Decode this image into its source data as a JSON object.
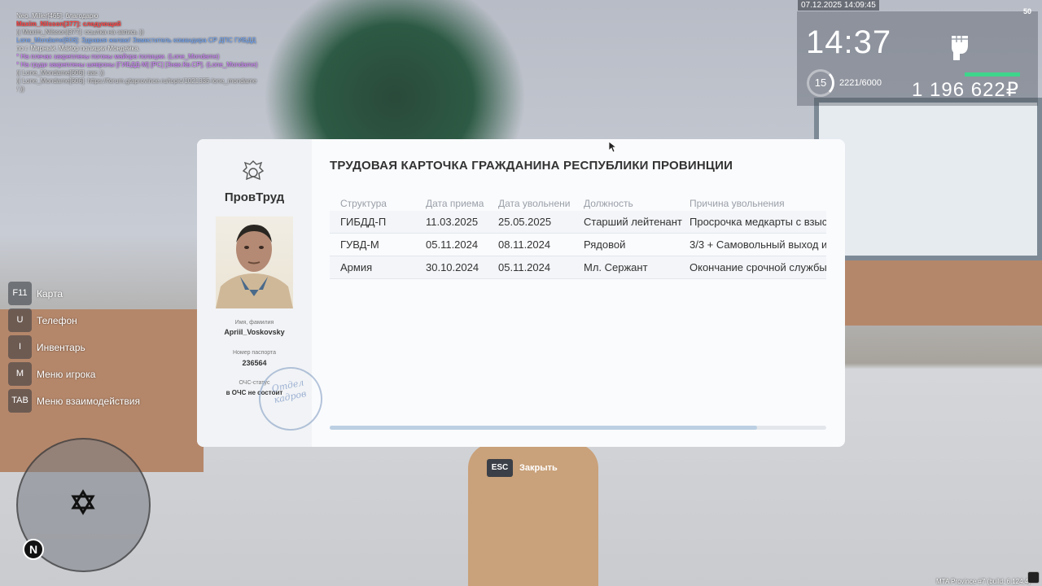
{
  "chat": [
    {
      "text": "Neo_Miller[465]: благодарю",
      "color": "#e8e8e8"
    },
    {
      "text": "Maxim_Nilsson[377]: следующий",
      "color": "#ff4444"
    },
    {
      "text": "(( Maxim_Nilsson[377]: ссылка на запись ))",
      "color": "#cfcfcf"
    },
    {
      "text": "Lone_Mondame[606]: Здравия желаю! Заместитель командира СР ДПС ГИБДД",
      "color": "#6fa8ff"
    },
    {
      "text": "по г. Мирный, Майор полиции Мондейка.",
      "color": "#e8e8e8"
    },
    {
      "text": "* На плечах закреплены погоны майора полиции. (Lone_Mondame)",
      "color": "#d07dff"
    },
    {
      "text": "* На груди закреплены шевроны [ГИБДД-М] [РС] [Знак.Кв.СР]. (Lone_Mondame)",
      "color": "#d07dff"
    },
    {
      "text": "(( Lone_Mondame[606]: вас ))",
      "color": "#cfcfcf"
    },
    {
      "text": "(( Lone_Mondame[606]: https://forum.gtaprovince.ru/topic/1021335-lone_mondame",
      "color": "#cfcfcf"
    },
    {
      "text": "/ ))",
      "color": "#cfcfcf"
    }
  ],
  "hud": {
    "datetime": "07.12.2025 14:09:45",
    "fps": "50",
    "time": "14:37",
    "level": "15",
    "xp": "2221/6000",
    "money": "1 196 622₽"
  },
  "card": {
    "brand": "ПровТруд",
    "title": "ТРУДОВАЯ КАРТОЧКА ГРАЖДАНИНА РЕСПУБЛИКИ ПРОВИНЦИИ",
    "name_label": "Имя, фамилия",
    "name": "Apriil_Voskovsky",
    "passport_label": "Номер паспорта",
    "passport": "236564",
    "ochs_label": "ОЧС-статус",
    "ochs": "в ОЧС не состоит",
    "stamp": "Отдел кадров",
    "columns": [
      "Структура",
      "Дата приема",
      "Дата увольнени",
      "Должность",
      "Причина увольнения"
    ],
    "rows": [
      [
        "ГИБДД-П",
        "11.03.2025",
        "25.05.2025",
        "Старший лейтенант",
        "Просрочка медкарты с взыск"
      ],
      [
        "ГУВД-М",
        "05.11.2024",
        "08.11.2024",
        "Рядовой",
        "3/3 + Самовольный выход и"
      ],
      [
        "Армия",
        "30.10.2024",
        "05.11.2024",
        "Мл. Сержант",
        "Окончание срочной службы."
      ]
    ],
    "scroll_fraction": 0.86
  },
  "menu": [
    {
      "key": "F11",
      "label": "Карта"
    },
    {
      "key": "U",
      "label": "Телефон"
    },
    {
      "key": "I",
      "label": "Инвентарь"
    },
    {
      "key": "M",
      "label": "Меню игрока"
    },
    {
      "key": "TAB",
      "label": "Меню взаимодействия"
    }
  ],
  "close": {
    "key": "ESC",
    "label": "Закрыть"
  },
  "minimap": {
    "north": "N"
  },
  "build": "MTA Province #7 (build: 6.124.4)",
  "colors": {
    "accent_green": "#3fd48c",
    "card_bg": "#fafbfd"
  }
}
